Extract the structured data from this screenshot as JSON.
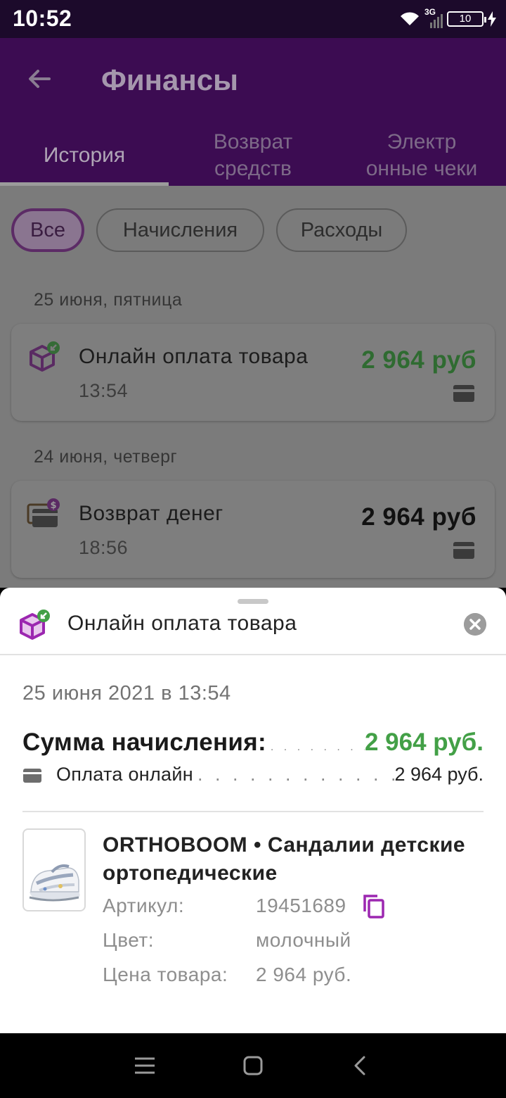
{
  "status_bar": {
    "time": "10:52",
    "network": "3G",
    "battery": "10"
  },
  "header": {
    "title": "Финансы"
  },
  "tabs": [
    {
      "label": "История",
      "active": true
    },
    {
      "label": "Возврат средств",
      "active": false
    },
    {
      "label": "Электронные чеки",
      "active": false
    }
  ],
  "filters": [
    {
      "label": "Все",
      "active": true
    },
    {
      "label": "Начисления",
      "active": false
    },
    {
      "label": "Расходы",
      "active": false
    }
  ],
  "groups": [
    {
      "date": "25 июня, пятница",
      "item": {
        "title": "Онлайн оплата товара",
        "time": "13:54",
        "amount": "2 964 руб",
        "amount_color": "#2e7d32",
        "icon": "box-incoming-icon"
      }
    },
    {
      "date": "24 июня, четверг",
      "item": {
        "title": "Возврат денег",
        "time": "18:56",
        "amount": "2 964 руб",
        "amount_color": "#111111",
        "icon": "card-refund-icon"
      }
    }
  ],
  "sheet": {
    "title": "Онлайн оплата товара",
    "date": "25 июня 2021 в 13:54",
    "sum_label": "Сумма начисления:",
    "sum_value": "2 964 руб.",
    "payment_label": "Оплата онлайн",
    "payment_value": "2 964 руб.",
    "product": {
      "title": "ORTHOBOOM • Сандалии детские ортопедические",
      "article_label": "Артикул:",
      "article_value": "19451689",
      "color_label": "Цвет:",
      "color_value": "молочный",
      "price_label": "Цена товара:",
      "price_value": "2 964 руб."
    }
  },
  "colors": {
    "accent": "#9c27b0",
    "positive": "#43a047",
    "header_dimmed": "#3c0c52"
  }
}
